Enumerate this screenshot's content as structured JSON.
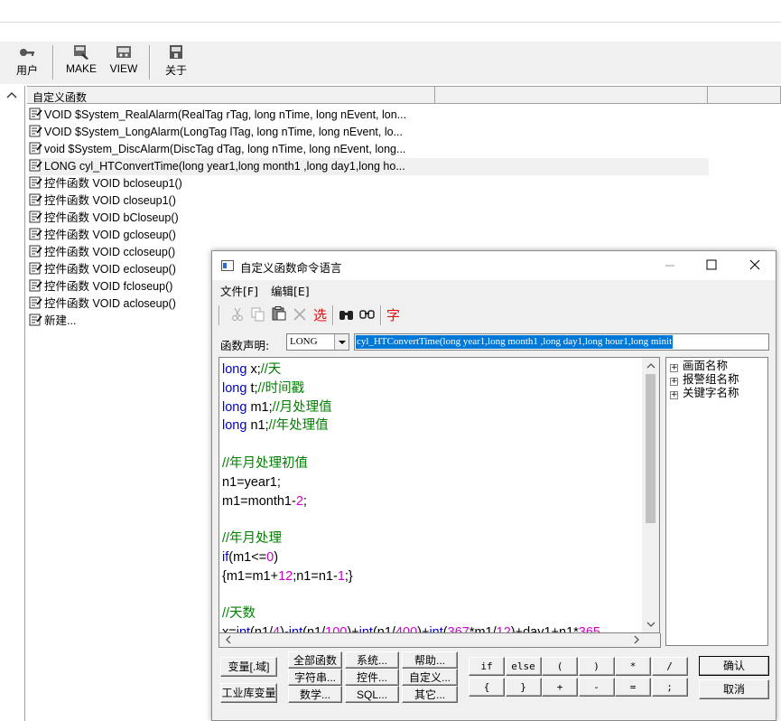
{
  "toolbar": [
    {
      "label": "用户",
      "icon": "user-key-icon"
    },
    {
      "label": "MAKE",
      "icon": "make-icon"
    },
    {
      "label": "VIEW",
      "icon": "view-icon"
    },
    {
      "label": "关于",
      "icon": "about-icon"
    }
  ],
  "list": {
    "header": "自定义函数",
    "rows": [
      "VOID $System_RealAlarm(RealTag rTag, long nTime, long nEvent, lon...",
      "VOID $System_LongAlarm(LongTag lTag, long nTime, long nEvent, lo...",
      "void $System_DiscAlarm(DiscTag dTag, long nTime, long nEvent, long...",
      "LONG cyl_HTConvertTime(long year1,long month1 ,long day1,long ho...",
      "控件函数 VOID bcloseup1()",
      "控件函数 VOID closeup1()",
      "控件函数 VOID bCloseup()",
      "控件函数 VOID gcloseup()",
      "控件函数 VOID ccloseup()",
      "控件函数 VOID ecloseup()",
      "控件函数 VOID fcloseup()",
      "控件函数 VOID acloseup()",
      "新建..."
    ],
    "selected_index": 3
  },
  "dialog": {
    "title": "自定义函数命令语言",
    "menu": [
      "文件[F]",
      "编辑[E]"
    ],
    "toolbar_icons": [
      "cut-icon",
      "copy-icon",
      "paste-icon",
      "delete-icon",
      "select-icon",
      "find-icon",
      "replace-icon",
      "font-icon"
    ],
    "select_label": "选",
    "font_label": "字",
    "decl_label": "函数声明:",
    "return_type": "LONG",
    "decl_value": "cyl_HTConvertTime(long year1,long month1 ,long day1,long hour1,long minit",
    "code_lines": [
      [
        {
          "t": "long",
          "c": "kw"
        },
        {
          "t": " x;",
          "c": ""
        },
        {
          "t": "//天",
          "c": "cm"
        }
      ],
      [
        {
          "t": "long",
          "c": "kw"
        },
        {
          "t": " t;",
          "c": ""
        },
        {
          "t": "//时间戳",
          "c": "cm"
        }
      ],
      [
        {
          "t": "long",
          "c": "kw"
        },
        {
          "t": " m1;",
          "c": ""
        },
        {
          "t": "//月处理值",
          "c": "cm"
        }
      ],
      [
        {
          "t": "long",
          "c": "kw"
        },
        {
          "t": " n1;",
          "c": ""
        },
        {
          "t": "//年处理值",
          "c": "cm"
        }
      ],
      [],
      [
        {
          "t": "//年月处理初值",
          "c": "cm"
        }
      ],
      [
        {
          "t": "n1=year1;",
          "c": ""
        }
      ],
      [
        {
          "t": "m1=month1-",
          "c": ""
        },
        {
          "t": "2",
          "c": "nm"
        },
        {
          "t": ";",
          "c": ""
        }
      ],
      [],
      [
        {
          "t": "//年月处理",
          "c": "cm"
        }
      ],
      [
        {
          "t": "if",
          "c": "kw"
        },
        {
          "t": "(m1<=",
          "c": ""
        },
        {
          "t": "0",
          "c": "nm"
        },
        {
          "t": ")",
          "c": ""
        }
      ],
      [
        {
          "t": "{m1=m1+",
          "c": ""
        },
        {
          "t": "12",
          "c": "nm"
        },
        {
          "t": ";n1=n1-",
          "c": ""
        },
        {
          "t": "1",
          "c": "nm"
        },
        {
          "t": ";}",
          "c": ""
        }
      ],
      [],
      [
        {
          "t": "//天数",
          "c": "cm"
        }
      ],
      [
        {
          "t": "x=",
          "c": ""
        },
        {
          "t": "int",
          "c": "kw"
        },
        {
          "t": "(n1/",
          "c": ""
        },
        {
          "t": "4",
          "c": "nm"
        },
        {
          "t": ")-",
          "c": ""
        },
        {
          "t": "int",
          "c": "kw"
        },
        {
          "t": "(n1/",
          "c": ""
        },
        {
          "t": "100",
          "c": "nm"
        },
        {
          "t": ")+",
          "c": ""
        },
        {
          "t": "int",
          "c": "kw"
        },
        {
          "t": "(n1/",
          "c": ""
        },
        {
          "t": "400",
          "c": "nm"
        },
        {
          "t": ")+",
          "c": ""
        },
        {
          "t": "int",
          "c": "kw"
        },
        {
          "t": "(",
          "c": ""
        },
        {
          "t": "367",
          "c": "nm"
        },
        {
          "t": "*m1/",
          "c": ""
        },
        {
          "t": "12",
          "c": "nm"
        },
        {
          "t": ")+day1+n1*",
          "c": ""
        },
        {
          "t": "365",
          "c": "nm"
        }
      ]
    ],
    "tree": [
      "画面名称",
      "报警组名称",
      "关键字名称"
    ],
    "buttons": {
      "var_field": "变量[.域]",
      "industrial_var": "工业库变量",
      "all_func": "全部函数",
      "system": "系统...",
      "help": "帮助...",
      "string": "字符串...",
      "control": "控件...",
      "custom": "自定义...",
      "math": "数学...",
      "sql": "SQL...",
      "other": "其它...",
      "ops_row1": [
        "if",
        "else",
        "(",
        ")",
        "*",
        "/"
      ],
      "ops_row2": [
        "{",
        "}",
        "+",
        "-",
        "=",
        ";"
      ],
      "ok": "确认",
      "cancel": "取消"
    }
  }
}
